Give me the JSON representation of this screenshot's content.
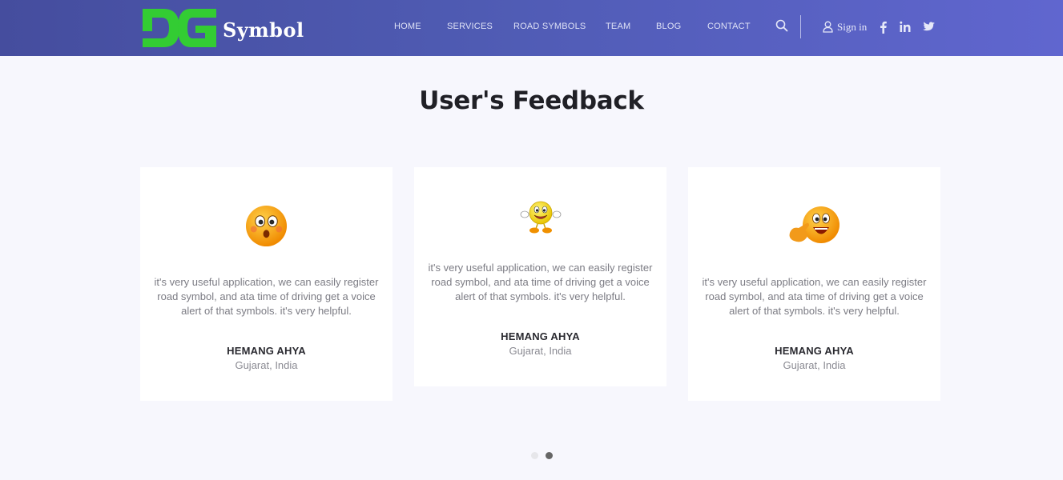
{
  "brand": {
    "name": "Symbol",
    "mark": "DG",
    "mark_color": "#33cc33"
  },
  "nav": {
    "items": [
      {
        "label": "HOME"
      },
      {
        "label": "SERVICES"
      },
      {
        "label": "ROAD SYMBOLS"
      },
      {
        "label": "TEAM"
      },
      {
        "label": "BLOG"
      },
      {
        "label": "CONTACT"
      }
    ],
    "signin_label": "Sign in",
    "icons": [
      "search-icon",
      "user-icon",
      "facebook-icon",
      "linkedin-icon",
      "twitter-icon"
    ]
  },
  "section": {
    "title": "User's Feedback"
  },
  "testimonials": [
    {
      "emoji": "shocked-face-icon",
      "quote": "it's very useful application, we can easily register road symbol, and ata time of driving get a voice alert of that symbols. it's very helpful.",
      "name": "HEMANG AHYA",
      "location": "Gujarat, India"
    },
    {
      "emoji": "happy-waving-face-icon",
      "quote": "it's very useful application, we can easily register road symbol, and ata time of driving get a voice alert of that symbols. it's very helpful.",
      "name": "HEMANG AHYA",
      "location": "Gujarat, India"
    },
    {
      "emoji": "laughing-face-icon",
      "quote": "it's very useful application, we can easily register road symbol, and ata time of driving get a voice alert of that symbols. it's very helpful.",
      "name": "HEMANG AHYA",
      "location": "Gujarat, India"
    }
  ],
  "carousel": {
    "pages": 2,
    "active_page": 2,
    "dot_active_color": "#666666",
    "dot_inactive_color": "#e6e6ea"
  },
  "colors": {
    "header_start": "#454d9e",
    "header_end": "#6066cf",
    "page_bg": "#f7f7fd",
    "card_bg": "#ffffff"
  }
}
